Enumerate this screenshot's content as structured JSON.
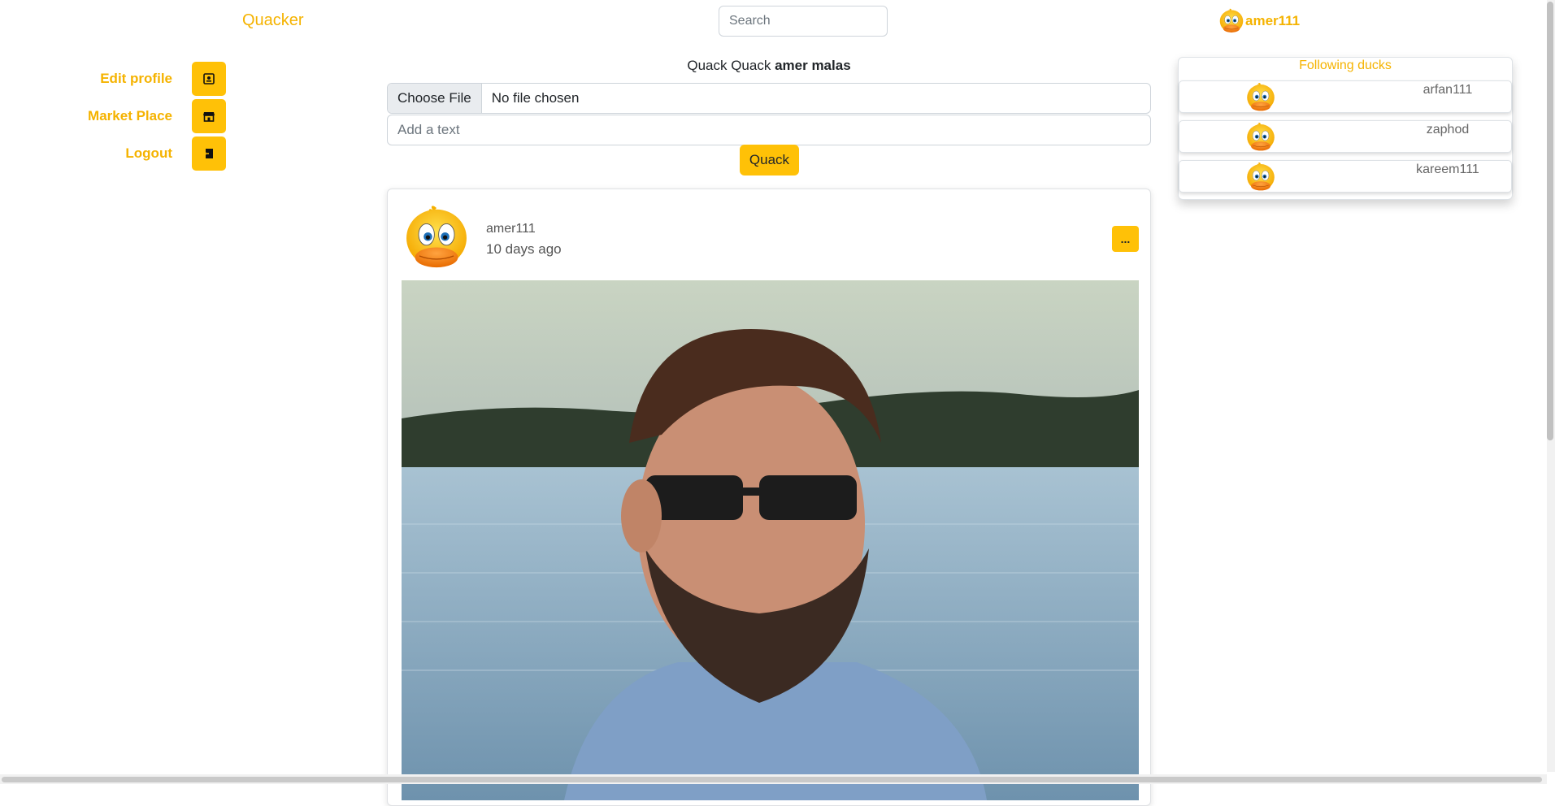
{
  "header": {
    "brand": "Quacker",
    "search_placeholder": "Search",
    "username": "amer111"
  },
  "sidebar": {
    "items": [
      {
        "label": "Edit profile",
        "icon": "id-card-icon"
      },
      {
        "label": "Market Place",
        "icon": "shop-icon"
      },
      {
        "label": "Logout",
        "icon": "logout-icon"
      }
    ]
  },
  "composer": {
    "greeting_prefix": "Quack Quack",
    "greeting_name": "amer malas",
    "file_button": "Choose File",
    "file_status": "No file chosen",
    "text_placeholder": "Add a text",
    "submit_label": "Quack"
  },
  "post": {
    "username": "amer111",
    "time": "10 days ago",
    "menu_label": "..."
  },
  "following": {
    "title": "Following ducks",
    "users": [
      "arfan111",
      "zaphod",
      "kareem111"
    ]
  },
  "colors": {
    "accent": "#ffc107",
    "brand": "#f5b301"
  }
}
